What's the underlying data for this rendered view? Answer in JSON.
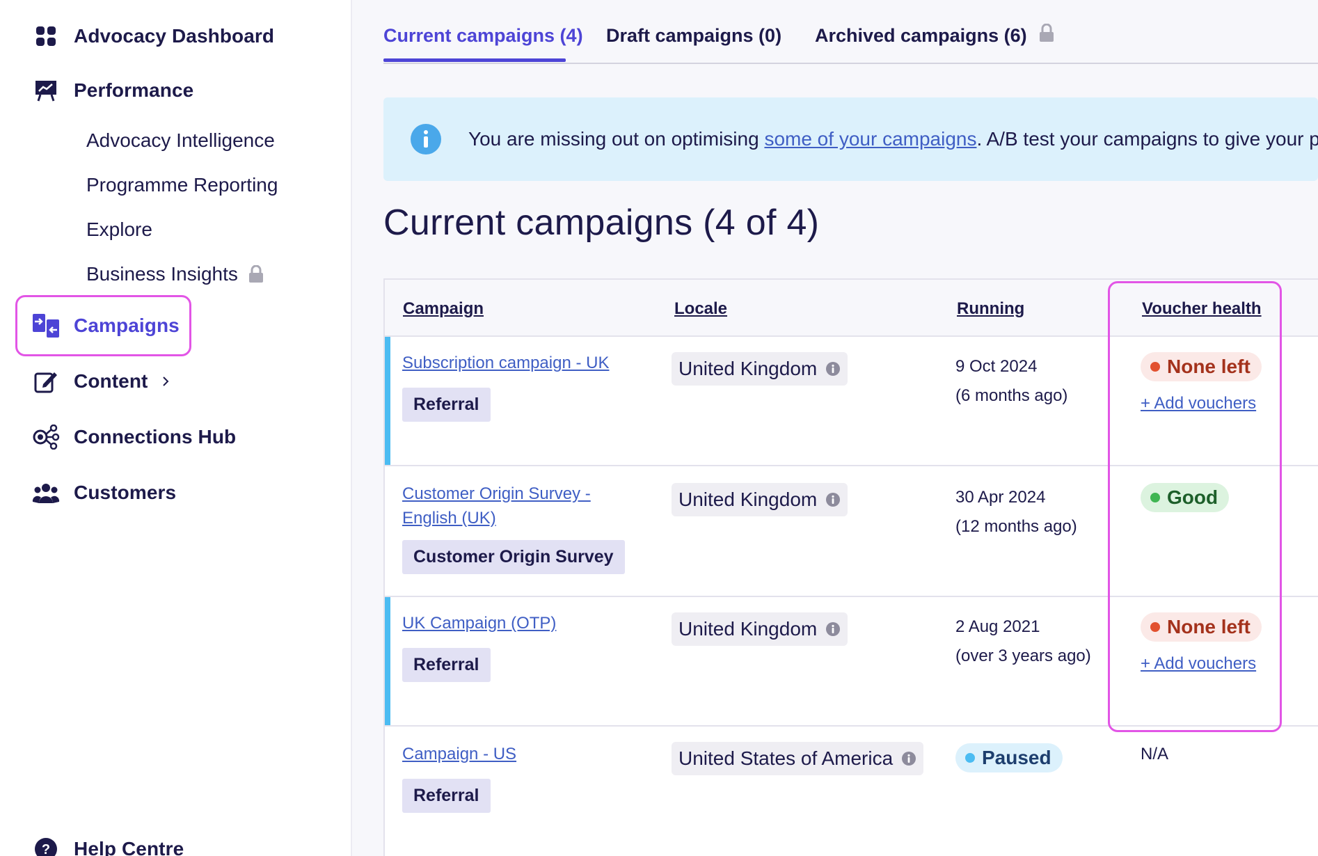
{
  "sidebar": {
    "items": [
      {
        "label": "Advocacy Dashboard",
        "icon": "dashboard-grid-icon"
      },
      {
        "label": "Performance",
        "icon": "presentation-chart-icon"
      },
      {
        "label": "Campaigns",
        "icon": "campaigns-arrows-icon",
        "active": true
      },
      {
        "label": "Content",
        "icon": "edit-icon"
      },
      {
        "label": "Connections Hub",
        "icon": "connections-hub-icon"
      },
      {
        "label": "Customers",
        "icon": "customers-icon"
      },
      {
        "label": "Help Centre",
        "icon": "help-icon"
      }
    ],
    "performance_sub": [
      {
        "label": "Advocacy Intelligence"
      },
      {
        "label": "Programme Reporting"
      },
      {
        "label": "Explore"
      },
      {
        "label": "Business Insights",
        "locked": true
      }
    ]
  },
  "tabs": [
    {
      "label": "Current campaigns (4)",
      "active": true
    },
    {
      "label": "Draft campaigns (0)"
    },
    {
      "label": "Archived campaigns (6)",
      "locked": true
    }
  ],
  "banner": {
    "text_before": "You are missing out on optimising ",
    "link_text": "some of your campaigns",
    "text_after": ". A/B test your campaigns to give your p"
  },
  "page_title": "Current campaigns (4 of 4)",
  "table": {
    "columns": [
      "Campaign",
      "Locale",
      "Running",
      "Voucher health"
    ],
    "rows": [
      {
        "name": "Subscription campaign - UK",
        "type": "Referral",
        "locale": "United Kingdom",
        "date": "9 Oct 2024",
        "ago": "(6 months ago)",
        "health": "None left",
        "add_link": "+ Add vouchers"
      },
      {
        "name": "Customer Origin Survey - English (UK)",
        "type": "Customer Origin Survey",
        "locale": "United Kingdom",
        "date": "30 Apr 2024",
        "ago": "(12 months ago)",
        "health": "Good"
      },
      {
        "name": "UK Campaign (OTP)",
        "type": "Referral",
        "locale": "United Kingdom",
        "date": "2 Aug 2021",
        "ago": "(over 3 years ago)",
        "health": "None left",
        "add_link": "+ Add vouchers"
      },
      {
        "name": "Campaign - US",
        "type": "Referral",
        "locale": "United States of America",
        "status": "Paused",
        "health": "N/A"
      }
    ]
  },
  "colors": {
    "accent": "#4d44d6",
    "highlight": "#e255e6",
    "link": "#3f5ec4",
    "row_accent": "#4bbcf2"
  }
}
